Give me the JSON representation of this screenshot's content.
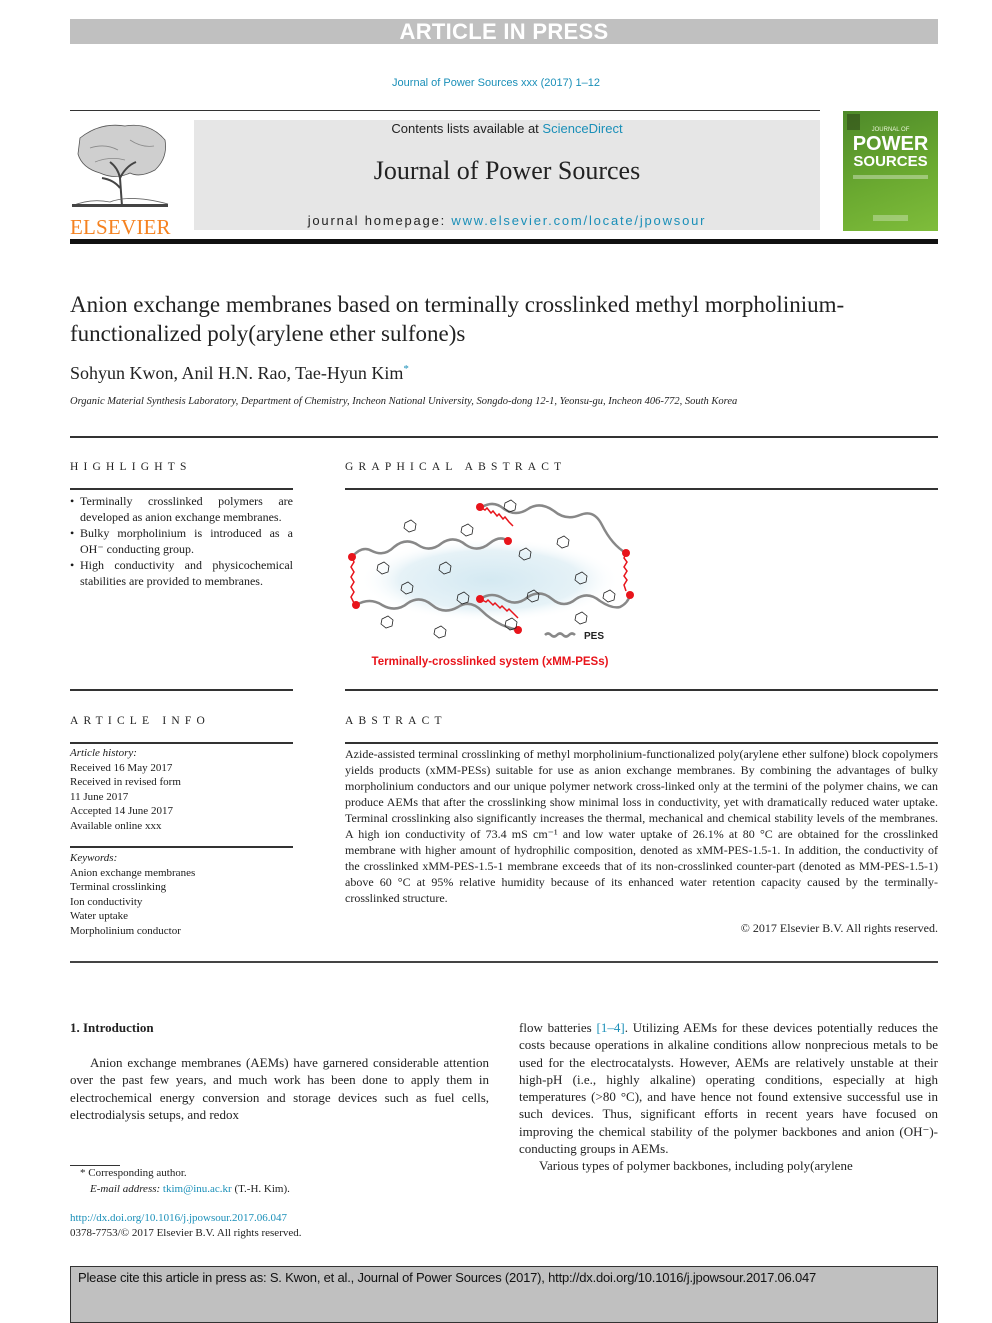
{
  "banner": {
    "label": "ARTICLE IN PRESS"
  },
  "journal_ref": "Journal of Power Sources xxx (2017) 1–12",
  "header": {
    "publisher_logo_text": "ELSEVIER",
    "contents_prefix": "Contents lists available at ",
    "contents_link": "ScienceDirect",
    "journal_name": "Journal of Power Sources",
    "homepage_prefix": "journal homepage: ",
    "homepage_url": "www.elsevier.com/locate/jpowsour",
    "cover": {
      "line1": "POWER",
      "line2": "SOURCES",
      "brand_color": "#6aa930"
    }
  },
  "article": {
    "title": "Anion exchange membranes based on terminally crosslinked methyl morpholinium-functionalized poly(arylene ether sulfone)s",
    "authors": "Sohyun Kwon, Anil H.N. Rao, Tae-Hyun Kim",
    "corresponding_mark": "*",
    "affiliation": "Organic Material Synthesis Laboratory, Department of Chemistry, Incheon National University, Songdo-dong 12-1, Yeonsu-gu, Incheon 406-772, South Korea"
  },
  "highlights": {
    "heading": "HIGHLIGHTS",
    "items": [
      "Terminally crosslinked polymers are developed as anion exchange membranes.",
      "Bulky morpholinium is introduced as a OH⁻ conducting group.",
      "High conductivity and physicochemical stabilities are provided to membranes."
    ]
  },
  "graphical_abstract": {
    "heading": "GRAPHICAL ABSTRACT",
    "legend_label": "PES",
    "caption": "Terminally-crosslinked system (xMM-PESs)",
    "accent_color": "#e8141b"
  },
  "article_info": {
    "heading": "ARTICLE INFO",
    "history_label": "Article history:",
    "history": [
      "Received 16 May 2017",
      "Received in revised form",
      "11 June 2017",
      "Accepted 14 June 2017",
      "Available online xxx"
    ],
    "keywords_label": "Keywords:",
    "keywords": [
      "Anion exchange membranes",
      "Terminal crosslinking",
      "Ion conductivity",
      "Water uptake",
      "Morpholinium conductor"
    ]
  },
  "abstract": {
    "heading": "ABSTRACT",
    "text": "Azide-assisted terminal crosslinking of methyl morpholinium-functionalized poly(arylene ether sulfone) block copolymers yields products (xMM-PESs) suitable for use as anion exchange membranes. By combining the advantages of bulky morpholinium conductors and our unique polymer network cross-linked only at the termini of the polymer chains, we can produce AEMs that after the crosslinking show minimal loss in conductivity, yet with dramatically reduced water uptake. Terminal crosslinking also significantly increases the thermal, mechanical and chemical stability levels of the membranes. A high ion conductivity of 73.4 mS cm⁻¹ and low water uptake of 26.1% at 80 °C are obtained for the crosslinked membrane with higher amount of hydrophilic composition, denoted as xMM-PES-1.5-1. In addition, the conductivity of the crosslinked xMM-PES-1.5-1 membrane exceeds that of its non-crosslinked counter-part (denoted as MM-PES-1.5-1) above 60 °C at 95% relative humidity because of its enhanced water retention capacity caused by the terminally-crosslinked structure.",
    "copyright": "© 2017 Elsevier B.V. All rights reserved."
  },
  "body": {
    "section_heading": "1.  Introduction",
    "col1_para": "Anion exchange membranes (AEMs) have garnered considerable attention over the past few years, and much work has been done to apply them in electrochemical energy conversion and storage devices such as fuel cells, electrodialysis setups, and redox",
    "col2_start": "flow batteries ",
    "col2_cite": "[1–4]",
    "col2_rest": ". Utilizing AEMs for these devices potentially reduces the costs because operations in alkaline conditions allow nonprecious metals to be used for the electrocatalysts. However, AEMs are relatively unstable at their high-pH (i.e., highly alkaline) operating conditions, especially at high temperatures (>80 °C), and have hence not found extensive successful use in such devices. Thus, significant efforts in recent years have focused on improving the chemical stability of the polymer backbones and anion (OH⁻)-conducting groups in AEMs.",
    "col2_para2": "Various types of polymer backbones, including poly(arylene"
  },
  "footnotes": {
    "corresponding": "* Corresponding author.",
    "email_label": "E-mail address: ",
    "email": "tkim@inu.ac.kr",
    "email_suffix": " (T.-H. Kim).",
    "doi_url": "http://dx.doi.org/10.1016/j.jpowsour.2017.06.047",
    "issn_copyright": "0378-7753/© 2017 Elsevier B.V. All rights reserved."
  },
  "cite_box": {
    "text": "Please cite this article in press as: S. Kwon, et al., Journal of Power Sources (2017), http://dx.doi.org/10.1016/j.jpowsour.2017.06.047"
  },
  "colors": {
    "link": "#1a8fb8",
    "elsevier_orange": "#f58220",
    "banner_gray": "#c0c0c0"
  }
}
